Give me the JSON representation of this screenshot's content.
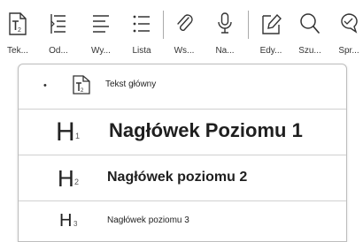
{
  "toolbar": {
    "items": [
      {
        "label": "Tek...",
        "icon": "text-style-icon"
      },
      {
        "label": "Od...",
        "icon": "indent-icon"
      },
      {
        "label": "Wy...",
        "icon": "align-icon"
      },
      {
        "label": "Lista",
        "icon": "list-icon"
      },
      {
        "label": "Ws...",
        "icon": "attach-icon"
      },
      {
        "label": "Na...",
        "icon": "microphone-icon"
      },
      {
        "label": "Edy...",
        "icon": "edit-icon"
      },
      {
        "label": "Szu...",
        "icon": "search-icon"
      },
      {
        "label": "Spr...",
        "icon": "spellcheck-icon"
      }
    ]
  },
  "dropdown": {
    "items": [
      {
        "label": "Tekst główny",
        "selected": true
      },
      {
        "label": "Nagłówek Poziomu 1",
        "level": "1"
      },
      {
        "label": "Nagłówek poziomu 2",
        "level": "2"
      },
      {
        "label": "Nagłówek poziomu 3",
        "level": "3"
      }
    ],
    "bullet": "•"
  },
  "colors": {
    "ink": "#222222",
    "border": "#bdbdbd"
  }
}
